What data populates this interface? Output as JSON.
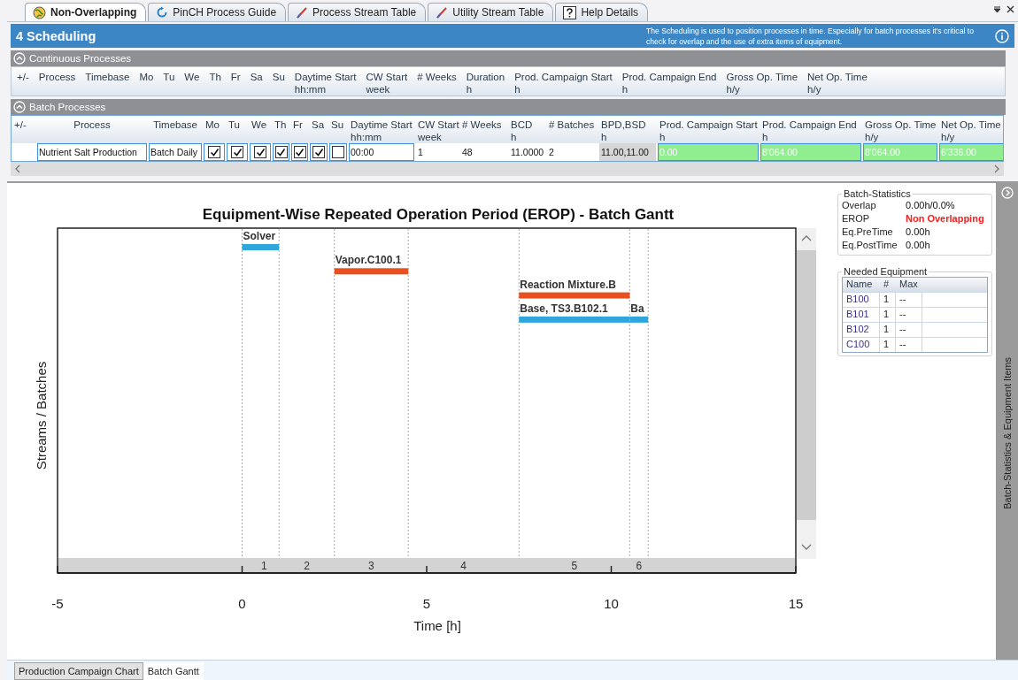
{
  "tabs": [
    {
      "label": "Non-Overlapping",
      "selected": true,
      "kind": "globe"
    },
    {
      "label": "PinCH Process Guide",
      "selected": false,
      "kind": "refresh"
    },
    {
      "label": "Process Stream Table",
      "selected": false,
      "kind": "pen"
    },
    {
      "label": "Utility Stream Table",
      "selected": false,
      "kind": "pen"
    },
    {
      "label": "Help Details",
      "selected": false,
      "kind": "help"
    }
  ],
  "header": {
    "title": "4 Scheduling",
    "description": "The Scheduling is used to position processes in time. Especially for batch processes it's critical to check for overlap and the use of extra items of equipment."
  },
  "continuous": {
    "title": "Continuous Processes",
    "expanded": true,
    "columns": [
      {
        "label": "+/-"
      },
      {
        "label": "Process"
      },
      {
        "label": "Timebase"
      },
      {
        "label": "Mo"
      },
      {
        "label": "Tu"
      },
      {
        "label": "We"
      },
      {
        "label": "Th"
      },
      {
        "label": "Fr"
      },
      {
        "label": "Sa"
      },
      {
        "label": "Su"
      },
      {
        "label": "Daytime Start",
        "unit": "hh:mm"
      },
      {
        "label": "CW Start",
        "unit": "week"
      },
      {
        "label": "# Weeks"
      },
      {
        "label": "Duration",
        "unit": "h"
      },
      {
        "label": "Prod. Campaign Start",
        "unit": "h"
      },
      {
        "label": "Prod. Campaign End",
        "unit": "h"
      },
      {
        "label": "Gross Op. Time",
        "unit": "h/y"
      },
      {
        "label": "Net Op. Time",
        "unit": "h/y"
      }
    ]
  },
  "batch": {
    "title": "Batch Processes",
    "expanded": true,
    "columns": [
      {
        "label": "+/-"
      },
      {
        "label": "Process"
      },
      {
        "label": "Timebase"
      },
      {
        "label": "Mo"
      },
      {
        "label": "Tu"
      },
      {
        "label": "We"
      },
      {
        "label": "Th"
      },
      {
        "label": "Fr"
      },
      {
        "label": "Sa"
      },
      {
        "label": "Su"
      },
      {
        "label": "Daytime Start",
        "unit": "hh:mm"
      },
      {
        "label": "CW Start",
        "unit": "week"
      },
      {
        "label": "# Weeks"
      },
      {
        "label": "BCD",
        "unit": "h"
      },
      {
        "label": "# Batches"
      },
      {
        "label": "BPD,BSD",
        "unit": "h"
      },
      {
        "label": "Prod. Campaign Start",
        "unit": "h"
      },
      {
        "label": "Prod. Campaign End",
        "unit": "h"
      },
      {
        "label": "Gross Op. Time",
        "unit": "h/y"
      },
      {
        "label": "Net Op. Time",
        "unit": "h/y"
      }
    ],
    "rows": [
      {
        "cells": [
          {
            "kind": "empty"
          },
          {
            "kind": "field",
            "text": "Nutrient Salt Production"
          },
          {
            "kind": "field",
            "text": "Batch Daily"
          },
          {
            "kind": "check",
            "checked": true
          },
          {
            "kind": "check",
            "checked": true
          },
          {
            "kind": "check",
            "checked": true
          },
          {
            "kind": "check",
            "checked": true
          },
          {
            "kind": "check",
            "checked": true
          },
          {
            "kind": "check",
            "checked": true
          },
          {
            "kind": "check",
            "checked": false
          },
          {
            "kind": "field",
            "text": "00:00"
          },
          {
            "kind": "plain",
            "text": "1"
          },
          {
            "kind": "plain",
            "text": "48"
          },
          {
            "kind": "plain",
            "text": "11.0000"
          },
          {
            "kind": "plain",
            "text": "2"
          },
          {
            "kind": "readonly",
            "text": "11.00,11.00"
          },
          {
            "kind": "result",
            "text": "0.00"
          },
          {
            "kind": "result",
            "text": "8'064.00"
          },
          {
            "kind": "result",
            "text": "8'064.00"
          },
          {
            "kind": "result",
            "text": "6'336.00"
          }
        ]
      }
    ]
  },
  "chart": {
    "rows": [
      {
        "bars": [
          {
            "label": "Solver",
            "color": "#2fa6dc"
          }
        ]
      },
      {
        "bars": [
          {
            "label": "Vapor.C100.1",
            "color": "#e8501f"
          }
        ]
      },
      {
        "bars": [
          {
            "label": "Reaction Mixture.B",
            "color": "#e8501f"
          }
        ]
      },
      {
        "bars": [
          {
            "label": "Base, TS3.B102.1",
            "color": "#2fa6dc"
          },
          {
            "label": "Ba",
            "color": "#2fa6dc"
          }
        ]
      }
    ],
    "segments": [
      "1",
      "2",
      "3",
      "4",
      "5",
      "6"
    ],
    "title": "Equipment-Wise Repeated Operation Period (EROP) - Batch Gantt",
    "xlabel": "Time [h]",
    "ylabel": "Streams / Batches",
    "ticks": [
      "-5",
      "0",
      "5",
      "10",
      "15"
    ]
  },
  "statistics": {
    "title": "Batch-Statistics",
    "rows": [
      {
        "label": "Overlap",
        "value": "0.00h/0.0%",
        "alert": false
      },
      {
        "label": "EROP",
        "value": "Non Overlapping",
        "alert": true
      },
      {
        "label": "Eq.PreTime",
        "value": "0.00h",
        "alert": false
      },
      {
        "label": "Eq.PostTime",
        "value": "0.00h",
        "alert": false
      }
    ]
  },
  "equipment": {
    "title": "Needed Equipment",
    "columns": [
      "Name",
      "#",
      "Max"
    ],
    "rows": [
      [
        "B100",
        "1",
        "--"
      ],
      [
        "B101",
        "1",
        "--"
      ],
      [
        "B102",
        "1",
        "--"
      ],
      [
        "C100",
        "1",
        "--"
      ]
    ]
  },
  "side_panel": {
    "label": "Batch-Statistics & Equipment Items"
  },
  "bottom_tabs": [
    {
      "label": "Production Campaign Chart",
      "selected": false
    },
    {
      "label": "Batch Gantt",
      "selected": true
    }
  ]
}
